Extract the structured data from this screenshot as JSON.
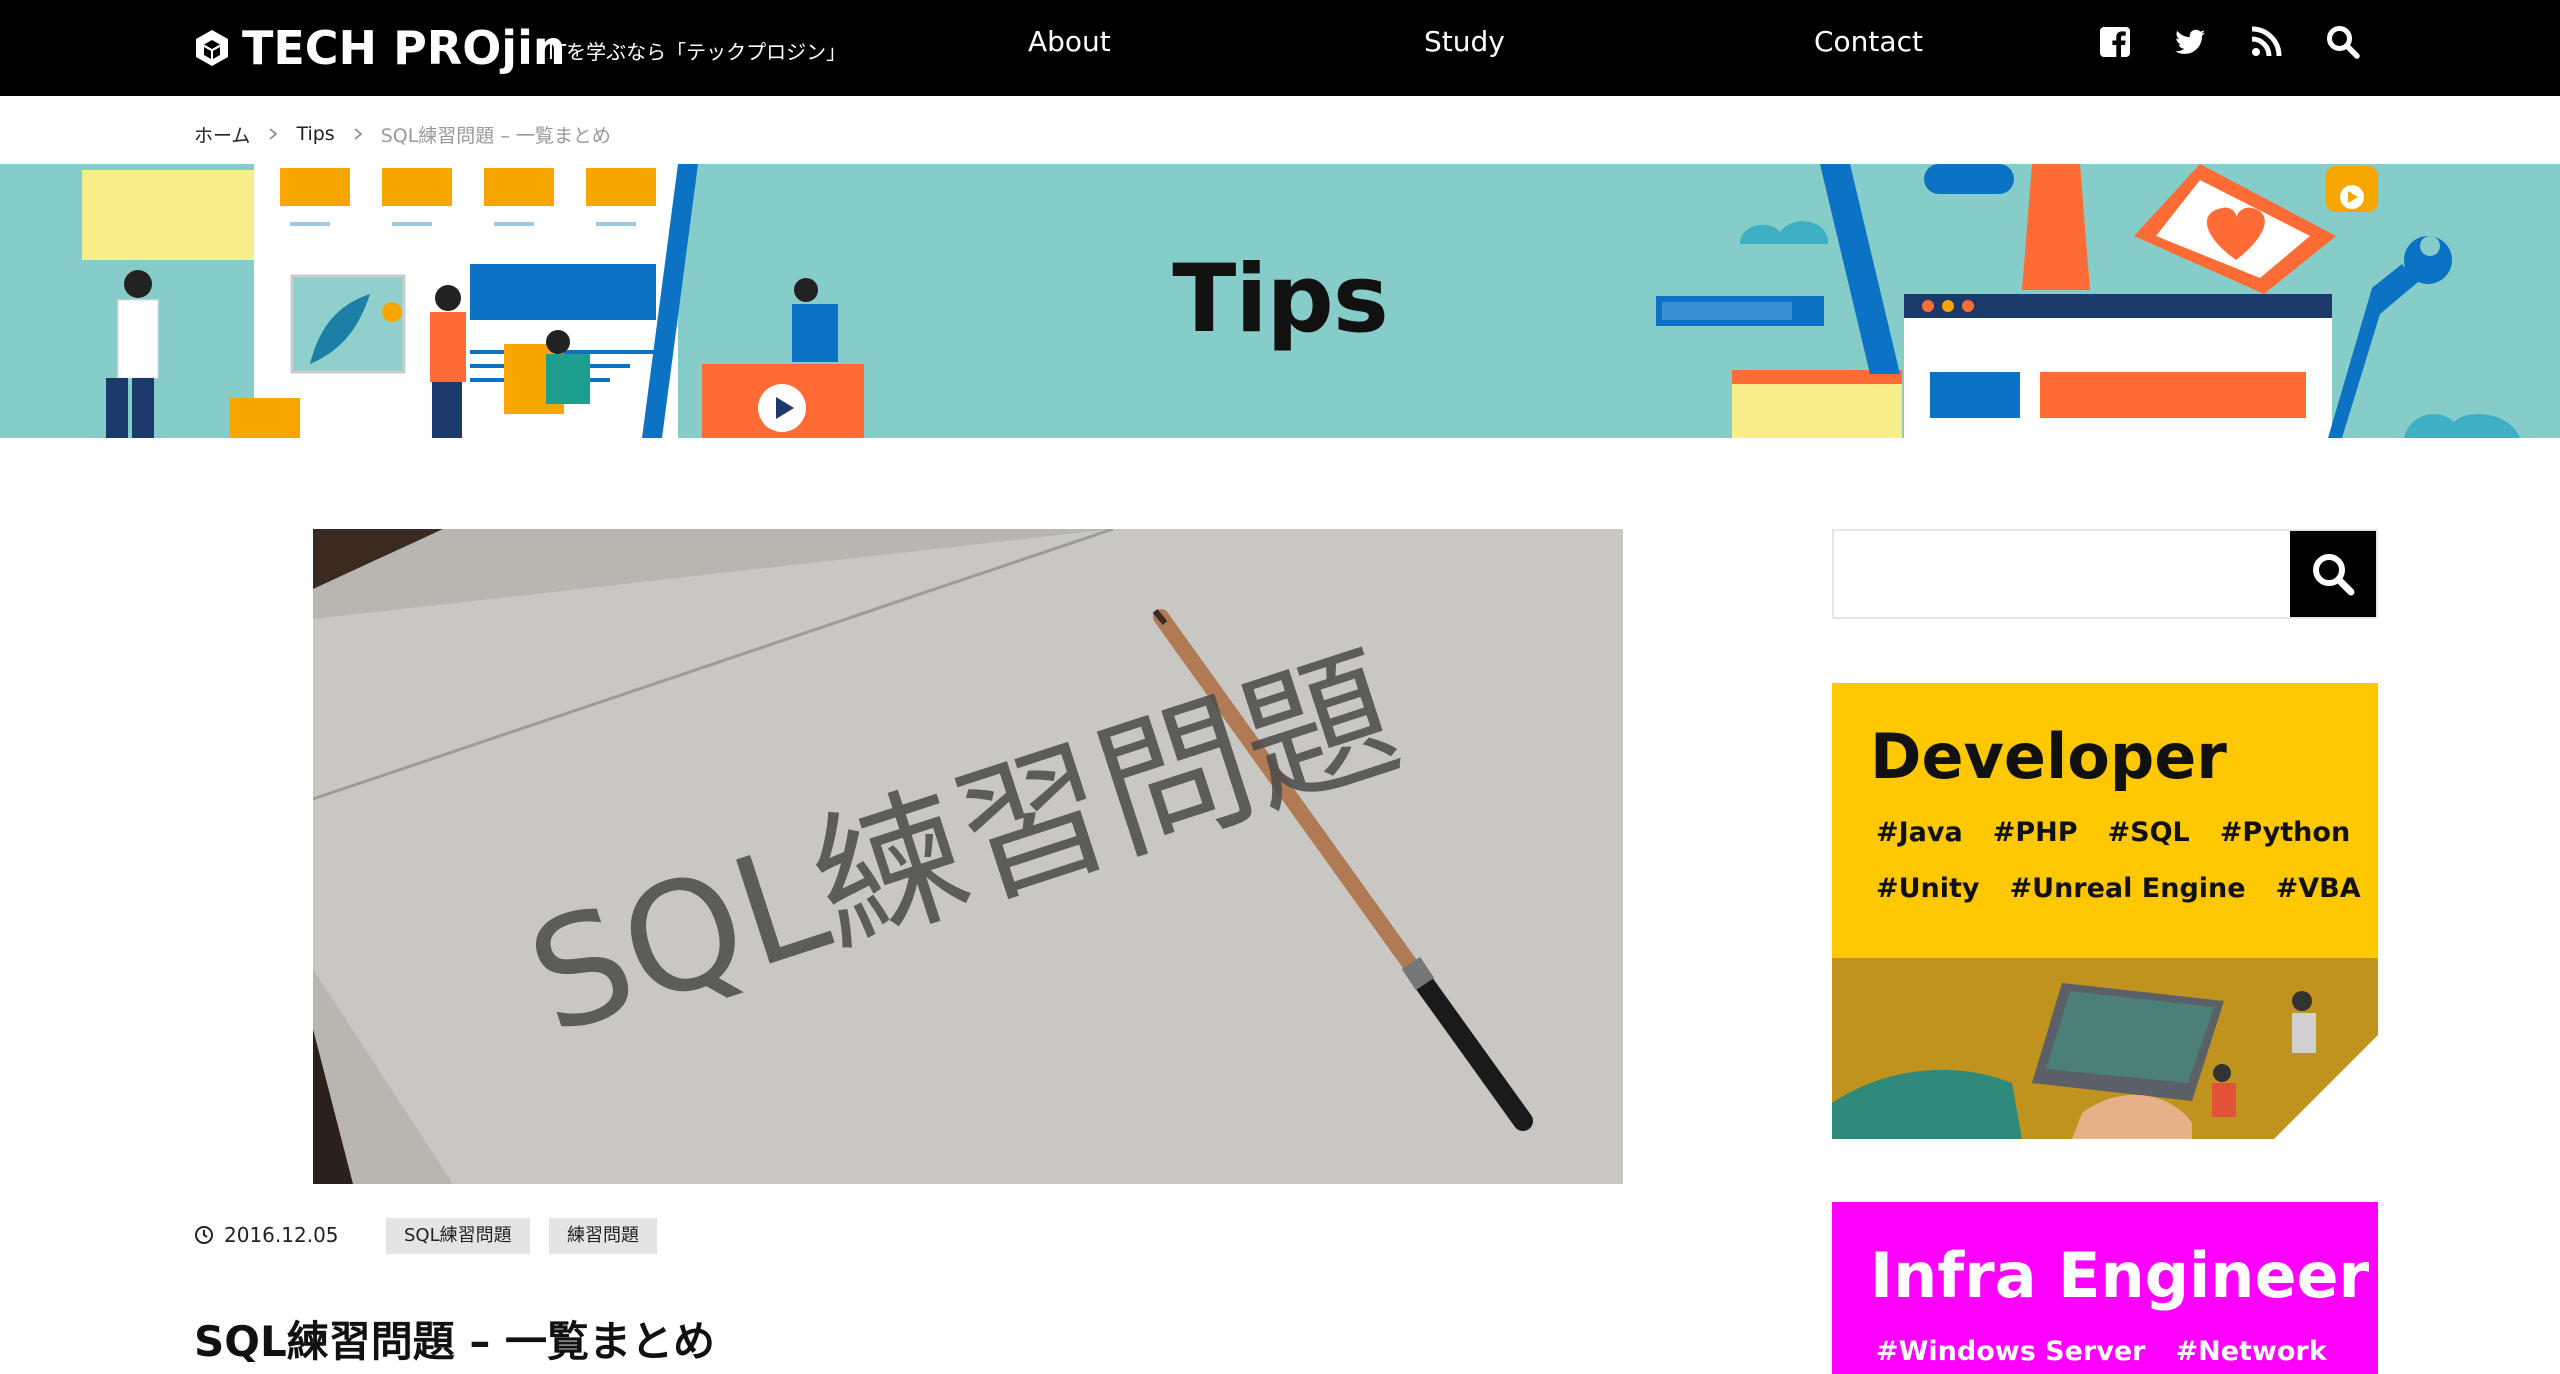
{
  "header": {
    "logo_text": "TECH PROjin",
    "tagline": "ITを学ぶなら「テックプロジン」",
    "nav": {
      "about": "About",
      "study": "Study",
      "contact": "Contact"
    },
    "icons": [
      "facebook-icon",
      "twitter-icon",
      "rss-icon",
      "search-icon"
    ]
  },
  "breadcrumb": {
    "home": "ホーム",
    "category": "Tips",
    "current": "SQL練習問題 – 一覧まとめ"
  },
  "hero": {
    "title": "Tips"
  },
  "article": {
    "date": "2016.12.05",
    "tags": [
      "SQL練習問題",
      "練習問題"
    ],
    "title": "SQL練習問題 – 一覧まとめ",
    "thumbnail_text": "SQL練習問題"
  },
  "sidebar": {
    "search": {
      "placeholder": ""
    },
    "developer_banner": {
      "title": "Developer",
      "tags_row1": [
        "#Java",
        "#PHP",
        "#SQL",
        "#Python"
      ],
      "tags_row2": [
        "#Unity",
        "#Unreal Engine",
        "#VBA"
      ]
    },
    "infra_banner": {
      "title": "Infra Engineer",
      "tags_row1": [
        "#Windows Server",
        "#Network"
      ]
    }
  },
  "colors": {
    "header_bg": "#000000",
    "hero_bg": "#86ccc9",
    "developer_banner": "#fdc800",
    "infra_banner": "#ff00ff",
    "tag_bg": "#e4e4e4"
  }
}
